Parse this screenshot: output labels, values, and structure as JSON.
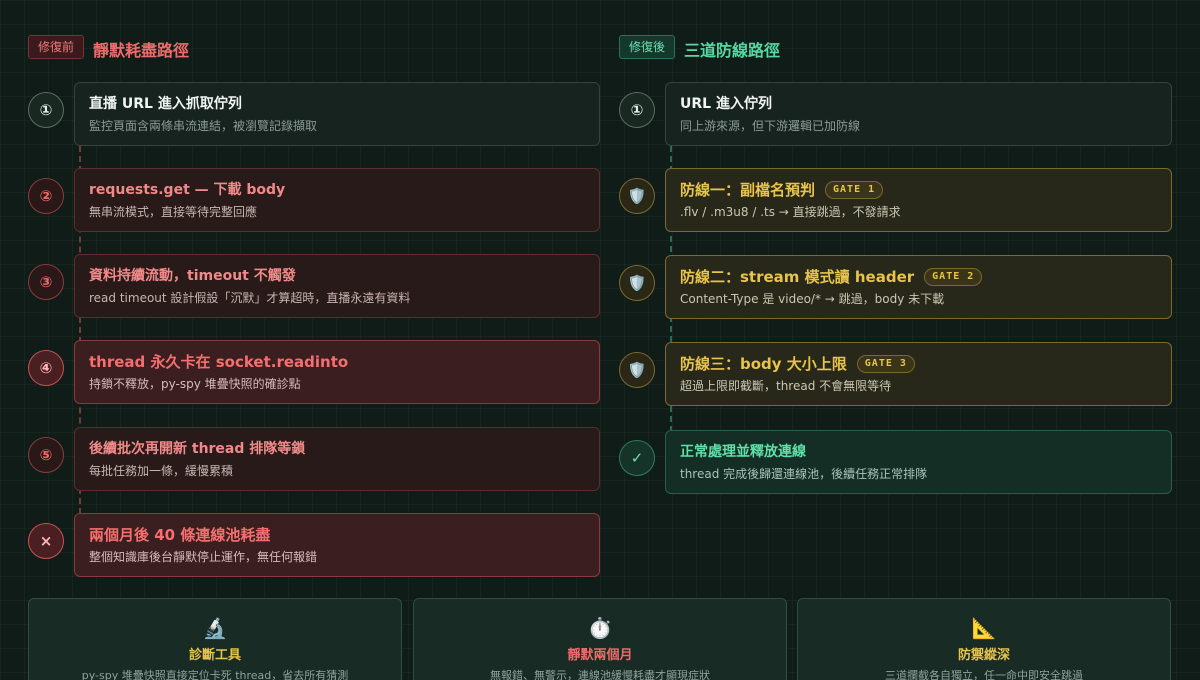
{
  "before": {
    "badge": "修復前",
    "title": "靜默耗盡路徑",
    "steps": [
      {
        "marker": "①",
        "title": "直播 URL 進入抓取佇列",
        "desc": "監控頁面含兩條串流連結，被瀏覽記錄擷取"
      },
      {
        "marker": "②",
        "title": "requests.get — 下載 body",
        "desc": "無串流模式，直接等待完整回應"
      },
      {
        "marker": "③",
        "title": "資料持續流動，timeout 不觸發",
        "desc": "read timeout 設計假設「沉默」才算超時，直播永遠有資料"
      },
      {
        "marker": "④",
        "title": "thread 永久卡在 socket.readinto",
        "desc": "持鎖不釋放，py-spy 堆疊快照的確診點"
      },
      {
        "marker": "⑤",
        "title": "後續批次再開新 thread 排隊等鎖",
        "desc": "每批任務加一條，緩慢累積"
      },
      {
        "marker": "×",
        "title": "兩個月後 40 條連線池耗盡",
        "desc": "整個知識庫後台靜默停止運作，無任何報錯"
      }
    ]
  },
  "after": {
    "badge": "修復後",
    "title": "三道防線路徑",
    "steps": [
      {
        "marker": "①",
        "title": "URL 進入佇列",
        "desc": "同上游來源，但下游邏輯已加防線"
      },
      {
        "marker": "🛡️",
        "title": "防線一：副檔名預判",
        "gate": "GATE 1",
        "desc": ".flv / .m3u8 / .ts → 直接跳過，不發請求"
      },
      {
        "marker": "🛡️",
        "title": "防線二：stream 模式讀 header",
        "gate": "GATE 2",
        "desc": "Content-Type 是 video/* → 跳過，body 未下載"
      },
      {
        "marker": "🛡️",
        "title": "防線三：body 大小上限",
        "gate": "GATE 3",
        "desc": "超過上限即截斷，thread 不會無限等待"
      },
      {
        "marker": "✓",
        "title": "正常處理並釋放連線",
        "desc": "thread 完成後歸還連線池，後續任務正常排隊"
      }
    ]
  },
  "summary": [
    {
      "icon": "🔬",
      "title": "診斷工具",
      "desc": "py-spy 堆疊快照直接定位卡死 thread，省去所有猜測",
      "color": "#e8c449"
    },
    {
      "icon": "⏱️",
      "title": "靜默兩個月",
      "desc": "無報錯、無警示，連線池緩慢耗盡才顯現症狀",
      "color": "#ef6b6b"
    },
    {
      "icon": "📐",
      "title": "防禦縱深",
      "desc": "三道攔截各自獨立，任一命中即安全跳過",
      "color": "#e8c449"
    }
  ]
}
